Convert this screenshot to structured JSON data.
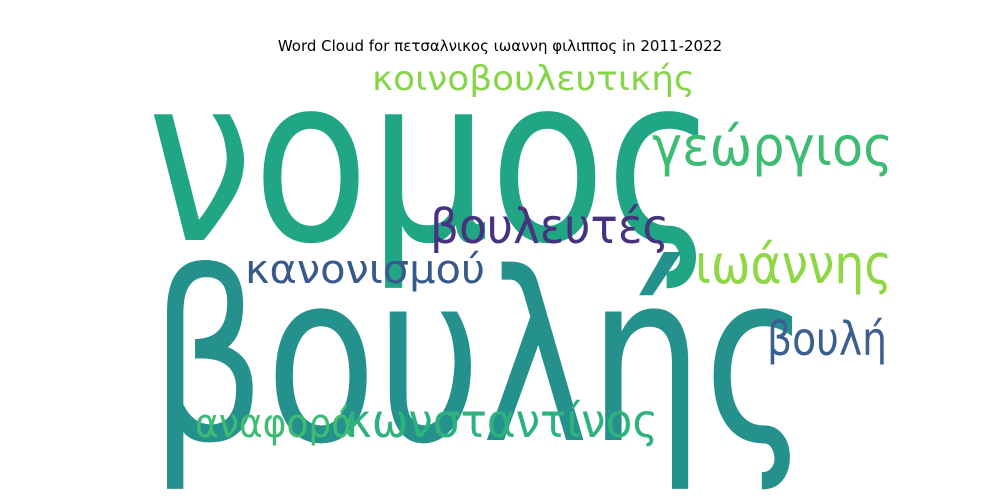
{
  "chart_data": {
    "type": "wordcloud",
    "title": "Word Cloud for πετσαλνικος ιωαννη φιλιππος in 2011-2022",
    "words": [
      {
        "text": "νομος",
        "weight": 1.0,
        "color": "#21a685"
      },
      {
        "text": "βουλής",
        "weight": 0.98,
        "color": "#25918d"
      },
      {
        "text": "κοινοβουλευτικής",
        "weight": 0.2,
        "color": "#86d549"
      },
      {
        "text": "γεώργιος",
        "weight": 0.32,
        "color": "#3fbc73"
      },
      {
        "text": "βουλευτές",
        "weight": 0.3,
        "color": "#46327e"
      },
      {
        "text": "κανονισμού",
        "weight": 0.22,
        "color": "#38598c"
      },
      {
        "text": "ιωάννης",
        "weight": 0.35,
        "color": "#8fd744"
      },
      {
        "text": "βουλή",
        "weight": 0.28,
        "color": "#3b5f8f"
      },
      {
        "text": "αναφορά",
        "weight": 0.22,
        "color": "#3fbc73"
      },
      {
        "text": "κωνσταντίνος",
        "weight": 0.28,
        "color": "#2db27d"
      }
    ]
  }
}
